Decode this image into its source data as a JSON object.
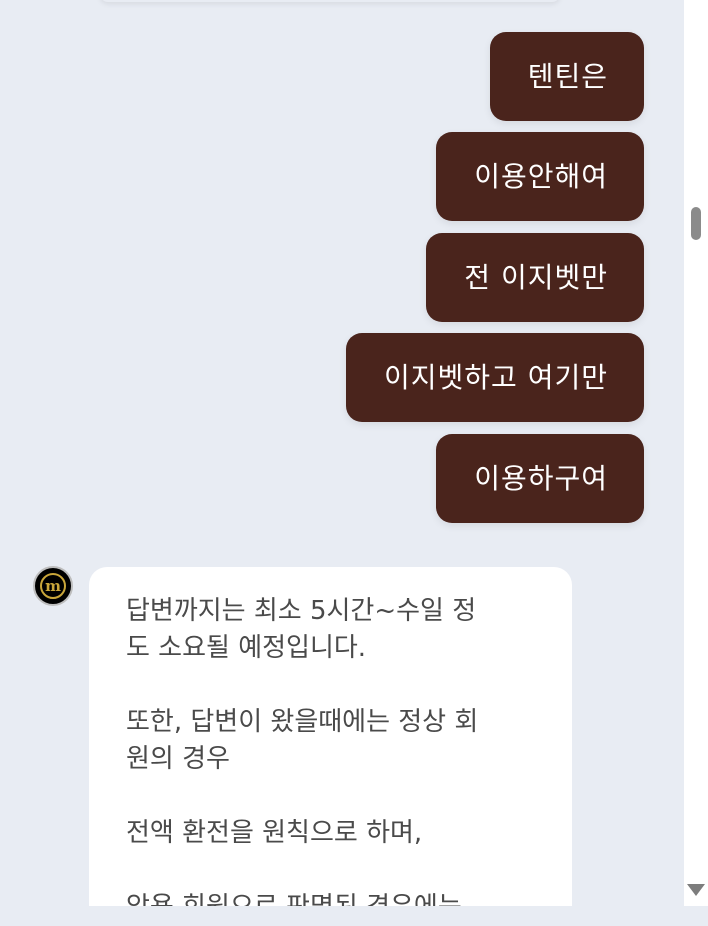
{
  "outgoing_messages": [
    "텐틴은",
    "이용안해여",
    "전 이지벳만",
    "이지벳하고 여기만",
    "이용하구여"
  ],
  "incoming_message": {
    "avatar_letter": "m",
    "lines": [
      "답변까지는 최소 5시간~수일 정",
      "도 소요될 예정입니다.",
      "",
      "또한, 답변이 왔을때에는 정상 회",
      "원의 경우",
      "",
      "전액 환전을 원칙으로 하며,",
      "",
      "악용 회원으로 판명된 경우에는"
    ]
  },
  "icons": {
    "scroll_down": "scroll-down-arrow-icon",
    "avatar": "brand-logo-icon"
  },
  "colors": {
    "outgoing_bubble": "#4a241c",
    "background": "#e8ecf3",
    "incoming_bubble": "#ffffff",
    "avatar_gold": "#c9a63a"
  }
}
